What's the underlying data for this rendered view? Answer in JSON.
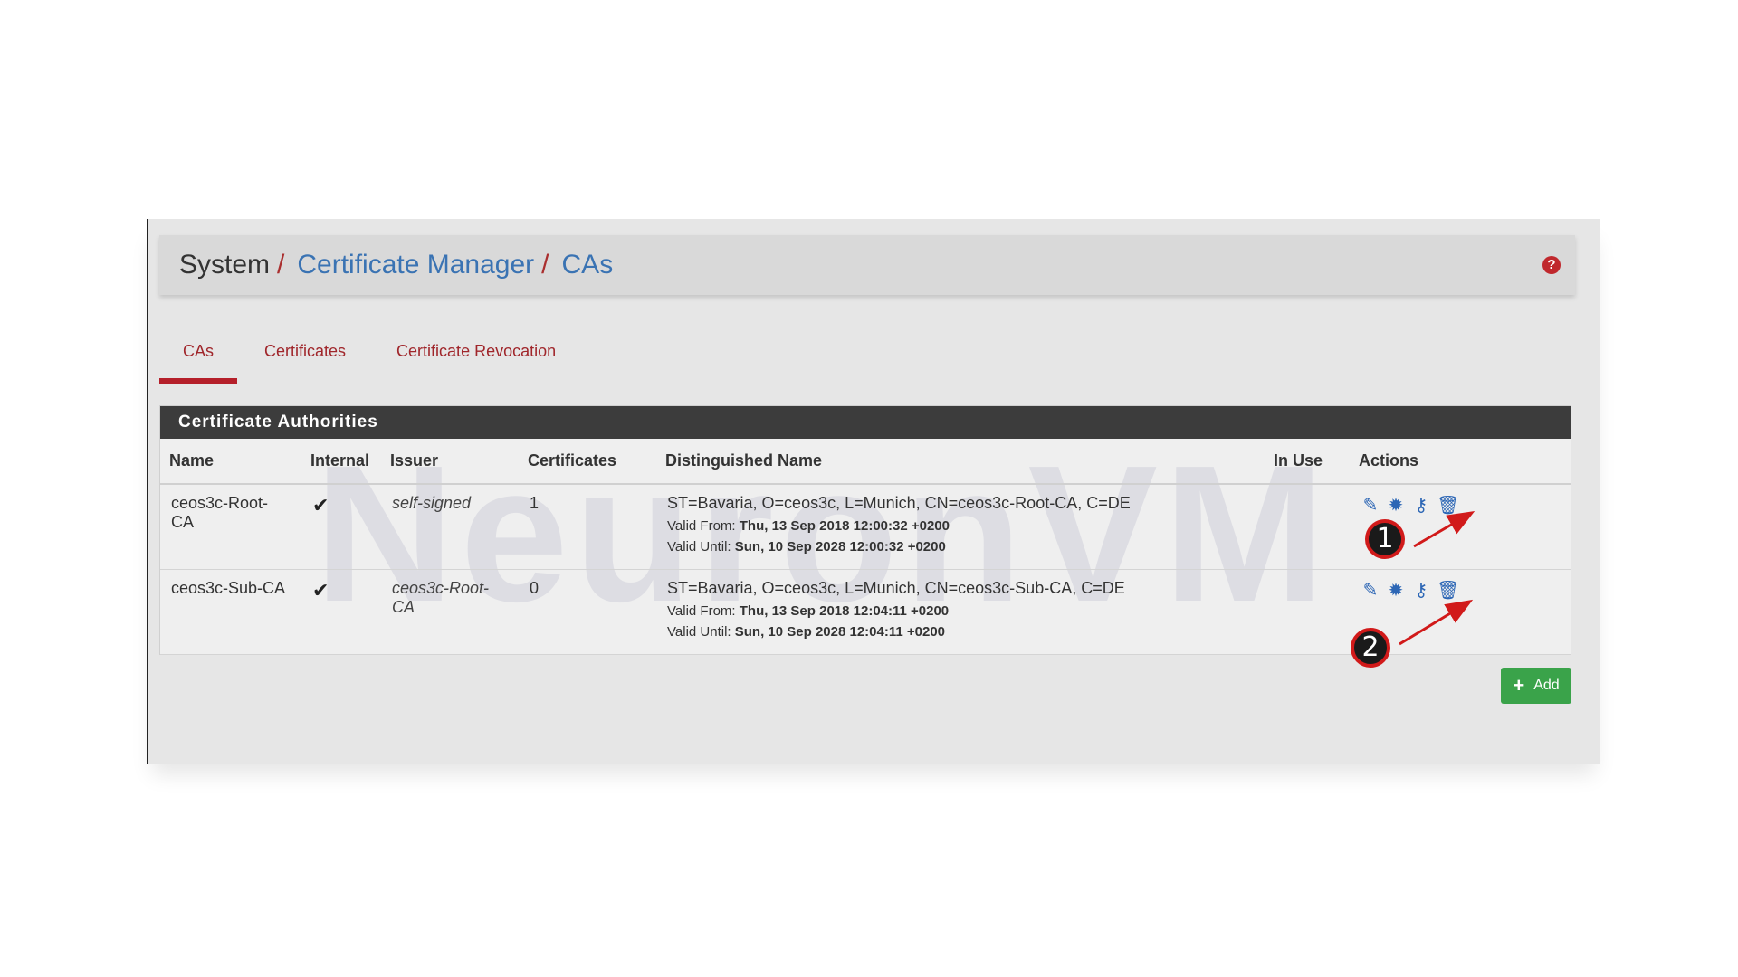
{
  "breadcrumb": {
    "system": "System",
    "sep1": "/",
    "certificate_manager": "Certificate Manager",
    "sep2": "/",
    "cas": "CAs",
    "help_icon": "question-circle-icon"
  },
  "tabs": [
    {
      "label": "CAs",
      "active": true
    },
    {
      "label": "Certificates",
      "active": false
    },
    {
      "label": "Certificate Revocation",
      "active": false
    }
  ],
  "panel": {
    "title": "Certificate Authorities",
    "watermark": "NeuronVM",
    "columns": [
      "Name",
      "Internal",
      "Issuer",
      "Certificates",
      "Distinguished Name",
      "In Use",
      "Actions"
    ],
    "rows": [
      {
        "name": "ceos3c-Root-CA",
        "internal": "✔",
        "issuer": "self-signed",
        "certificates": "1",
        "dn": "ST=Bavaria, O=ceos3c, L=Munich, CN=ceos3c-Root-CA, C=DE",
        "valid_from_label": "Valid From:",
        "valid_from": "Thu, 13 Sep 2018 12:00:32 +0200",
        "valid_until_label": "Valid Until:",
        "valid_until": "Sun, 10 Sep 2028 12:00:32 +0200",
        "in_use": ""
      },
      {
        "name": "ceos3c-Sub-CA",
        "internal": "✔",
        "issuer": "ceos3c-Root-CA",
        "certificates": "0",
        "dn": "ST=Bavaria, O=ceos3c, L=Munich, CN=ceos3c-Sub-CA, C=DE",
        "valid_from_label": "Valid From:",
        "valid_from": "Thu, 13 Sep 2018 12:04:11 +0200",
        "valid_until_label": "Valid Until:",
        "valid_until": "Sun, 10 Sep 2028 12:04:11 +0200",
        "in_use": ""
      }
    ],
    "action_icons": [
      "pencil-icon",
      "cog-icon",
      "key-icon",
      "trash-icon"
    ]
  },
  "add_button": {
    "label": "Add",
    "icon": "plus-icon"
  },
  "annotations": [
    "1",
    "2"
  ],
  "colors": {
    "accent_red": "#b51f2a",
    "link_blue": "#3a73b3",
    "action_blue": "#2c66b5",
    "add_green": "#3aa34a",
    "panel_heading": "#3c3c3c"
  }
}
